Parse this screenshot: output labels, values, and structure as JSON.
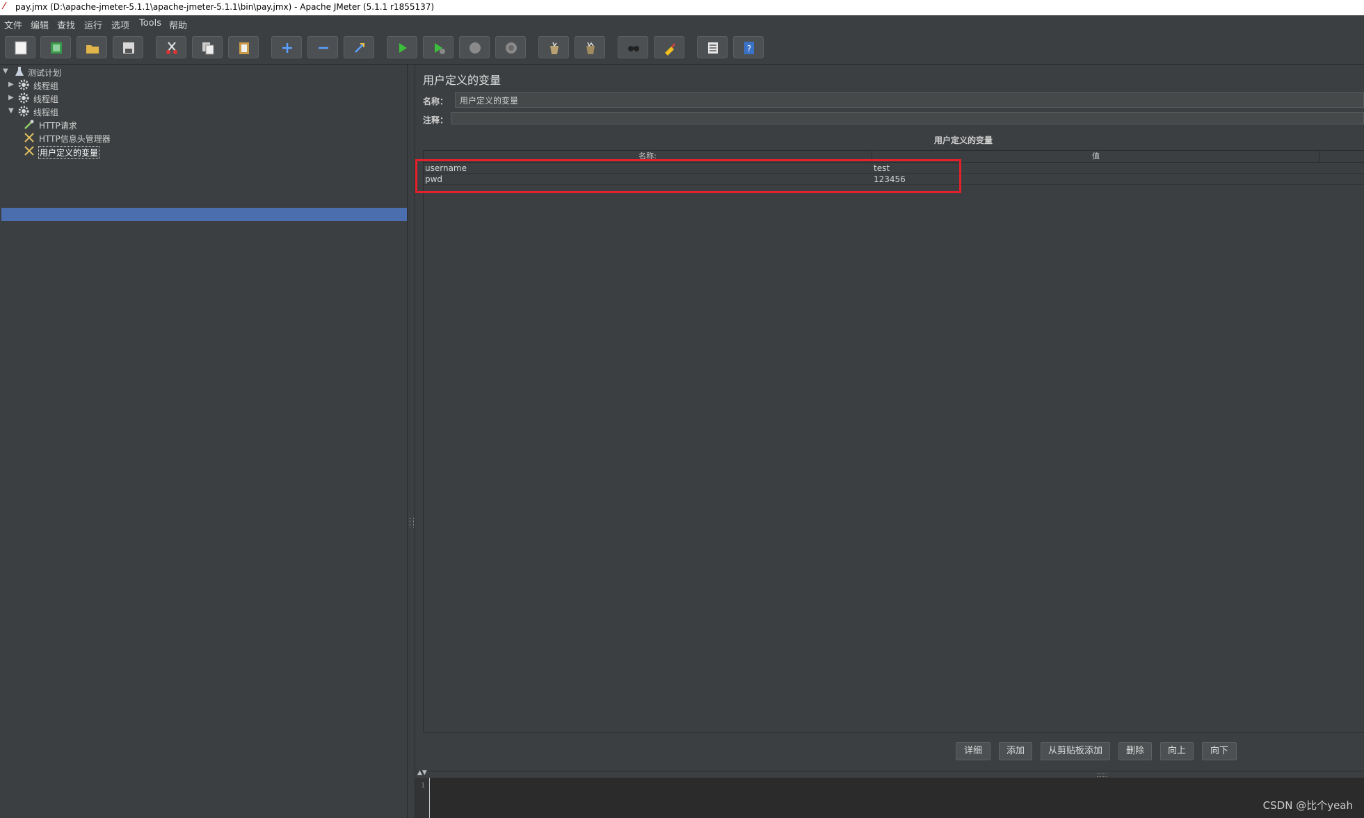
{
  "window": {
    "title": "pay.jmx (D:\\apache-jmeter-5.1.1\\apache-jmeter-5.1.1\\bin\\pay.jmx) - Apache JMeter (5.1.1 r1855137)",
    "app_icon": "jmeter-feather-icon"
  },
  "menu": {
    "items": [
      "文件",
      "编辑",
      "查找",
      "运行",
      "选项",
      "Tools",
      "帮助"
    ]
  },
  "toolbar": {
    "buttons": [
      "new-icon",
      "templates-icon",
      "open-icon",
      "save-icon",
      "cut-icon",
      "copy-icon",
      "paste-icon",
      "expand-icon",
      "collapse-icon",
      "toggle-icon",
      "start-icon",
      "start-no-pauses-icon",
      "stop-icon",
      "shutdown-icon",
      "clear-icon",
      "clear-all-icon",
      "search-icon",
      "reset-search-icon",
      "function-helper-icon",
      "help-icon"
    ]
  },
  "tree": {
    "items": [
      {
        "label": "测试计划",
        "icon": "flask-icon",
        "expanded": true
      },
      {
        "label": "线程组",
        "icon": "gear-icon",
        "expanded": false
      },
      {
        "label": "线程组",
        "icon": "gear-icon",
        "expanded": false
      },
      {
        "label": "线程组",
        "icon": "gear-icon",
        "expanded": true
      },
      {
        "label": "HTTP请求",
        "icon": "pipette-icon"
      },
      {
        "label": "HTTP信息头管理器",
        "icon": "wrench-icon"
      },
      {
        "label": "用户定义的变量",
        "icon": "wrench-icon",
        "selected": true
      }
    ]
  },
  "panel": {
    "title": "用户定义的变量",
    "name_label": "名称：",
    "name_value": "用户定义的变量",
    "comment_label": "注释：",
    "comment_value": "",
    "section_title": "用户定义的变量",
    "columns": [
      "名称:",
      "值"
    ],
    "rows": [
      {
        "name": "username",
        "value": "test"
      },
      {
        "name": "pwd",
        "value": "123456"
      }
    ],
    "buttons": [
      "详细",
      "添加",
      "从剪贴板添加",
      "删除",
      "向上",
      "向下"
    ]
  },
  "log": {
    "line_number": "1"
  },
  "watermark": "CSDN @比个yeah",
  "colors": {
    "background": "#3c3f41",
    "selection": "#4b6eaf",
    "highlight_box": "#e3202b"
  }
}
